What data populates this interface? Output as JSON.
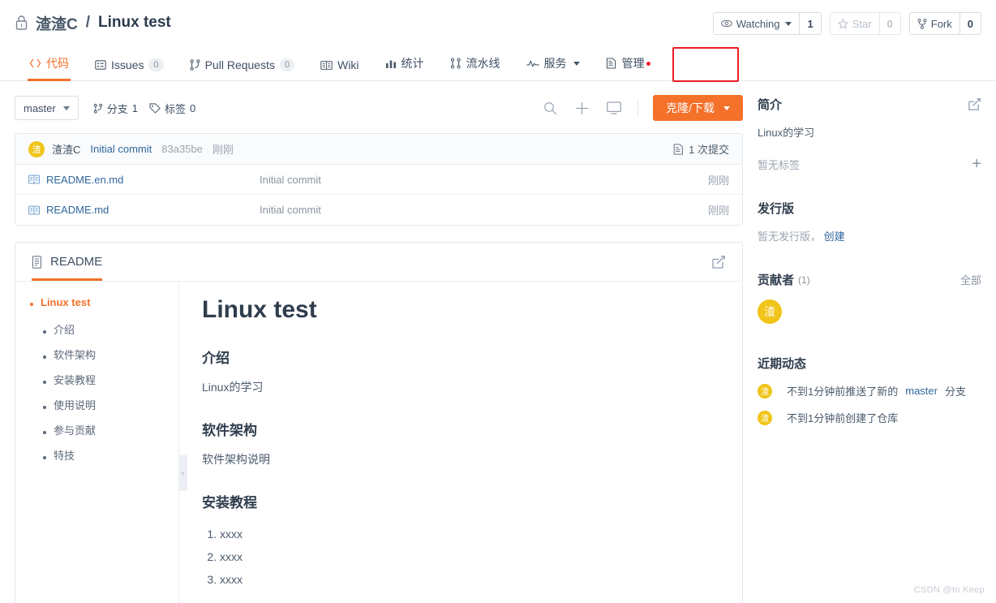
{
  "header": {
    "lock_icon": "lock-icon",
    "owner": "渣渣C",
    "separator": "/",
    "repo": "Linux test",
    "actions": {
      "watching": {
        "icon": "eye-icon",
        "label": "Watching",
        "count": "1"
      },
      "star": {
        "icon": "star-icon",
        "label": "Star",
        "count": "0"
      },
      "fork": {
        "icon": "fork-icon",
        "label": "Fork",
        "count": "0"
      }
    }
  },
  "nav": {
    "tabs": [
      {
        "icon": "code-icon",
        "label": "代码",
        "badge": null,
        "active": true
      },
      {
        "icon": "issues-icon",
        "label": "Issues",
        "badge": "0",
        "active": false
      },
      {
        "icon": "pull-request-icon",
        "label": "Pull Requests",
        "badge": "0",
        "active": false
      },
      {
        "icon": "wiki-icon",
        "label": "Wiki",
        "badge": null,
        "active": false
      },
      {
        "icon": "stats-icon",
        "label": "统计",
        "badge": null,
        "active": false
      },
      {
        "icon": "pipeline-icon",
        "label": "流水线",
        "badge": null,
        "active": false
      },
      {
        "icon": "service-icon",
        "label": "服务",
        "badge": null,
        "active": false,
        "caret": true
      },
      {
        "icon": "manage-icon",
        "label": "管理",
        "badge": null,
        "active": false,
        "dot": true
      }
    ],
    "highlight_color": "#ed1c24",
    "active_color": "#f4712a"
  },
  "toolbar": {
    "branch": "master",
    "branches_icon": "branch-icon",
    "branches_label": "分支",
    "branches_count": "1",
    "tags_icon": "tag-icon",
    "tags_label": "标签",
    "tags_count": "0",
    "search_icon": "search-icon",
    "add_icon": "plus-icon",
    "ide_icon": "monitor-icon",
    "clone_label": "克隆/下载",
    "clone_color": "#f4712a"
  },
  "commit_bar": {
    "avatar_initial": "渣",
    "author": "渣渣C",
    "message": "Initial commit",
    "sha": "83a35be",
    "time": "刚刚",
    "commits_icon": "commit-list-icon",
    "commits_label": "1 次提交"
  },
  "files": [
    {
      "icon": "file-icon",
      "name": "README.en.md",
      "commit": "Initial commit",
      "time": "刚刚"
    },
    {
      "icon": "file-icon",
      "name": "README.md",
      "commit": "Initial commit",
      "time": "刚刚"
    }
  ],
  "readme": {
    "tab_icon": "doc-icon",
    "tab_label": "README",
    "edit_icon": "edit-icon",
    "toc": {
      "top": "Linux test",
      "items": [
        "介绍",
        "软件架构",
        "安装教程",
        "使用说明",
        "参与贡献",
        "特技"
      ],
      "collapse_icon": "chevron-left-icon"
    },
    "content": {
      "title": "Linux test",
      "sections": [
        {
          "heading": "介绍",
          "paragraph": "Linux的学习"
        },
        {
          "heading": "软件架构",
          "paragraph": "软件架构说明"
        }
      ],
      "install_heading": "安装教程",
      "install_steps": [
        "xxxx",
        "xxxx",
        "xxxx"
      ]
    }
  },
  "sidebar": {
    "about": {
      "title": "简介",
      "edit_icon": "edit-icon",
      "description": "Linux的学习",
      "tags_empty": "暂无标签",
      "add_tag_icon": "plus-icon"
    },
    "releases": {
      "title": "发行版",
      "empty": "暂无发行版，",
      "create_link": "创建"
    },
    "contributors": {
      "title": "贡献者",
      "count": "(1)",
      "all_link": "全部",
      "avatars": [
        {
          "initial": "渣"
        }
      ]
    },
    "activity": {
      "title": "近期动态",
      "items": [
        {
          "avatar_initial": "渣",
          "prefix": "不到1分钟前推送了新的",
          "link": "master",
          "suffix": "分支"
        },
        {
          "avatar_initial": "渣",
          "prefix": "不到1分钟前创建了仓库",
          "link": "",
          "suffix": ""
        }
      ]
    }
  },
  "watermark": "CSDN @to Keep"
}
